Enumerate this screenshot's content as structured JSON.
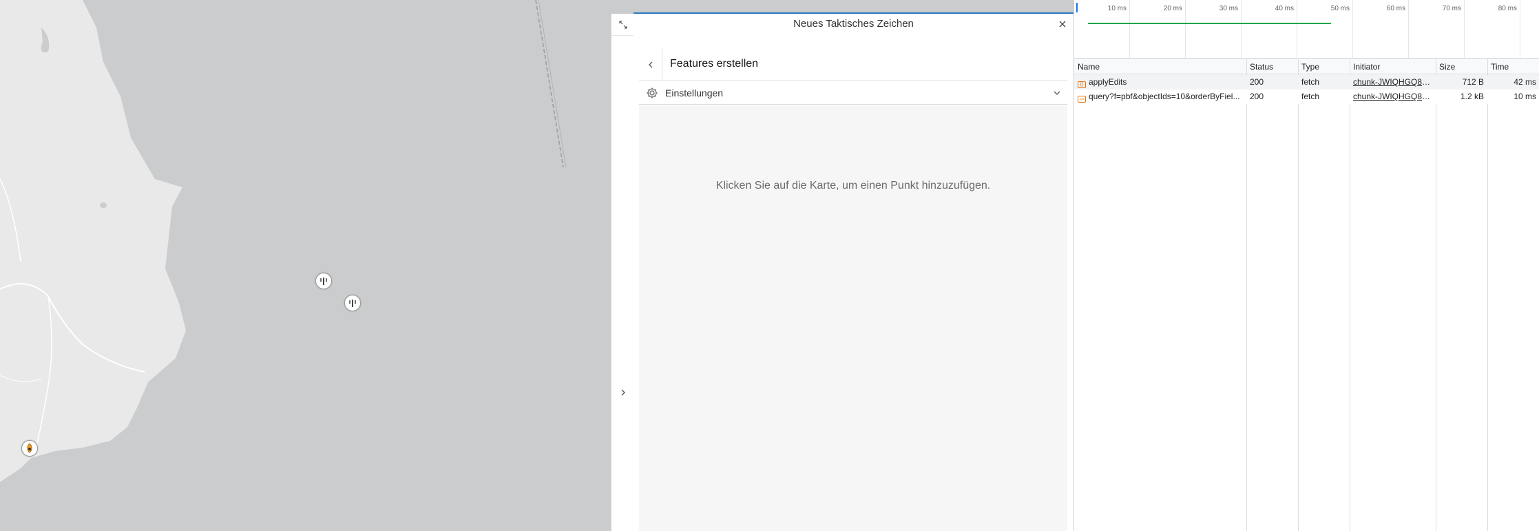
{
  "panel": {
    "title": "Neues Taktisches Zeichen",
    "features_title": "Features erstellen",
    "settings_label": "Einstellungen",
    "hint": "Klicken Sie auf die Karte, um einen Punkt hinzuzufügen."
  },
  "icons": {
    "expand": "expand-icon",
    "collapse": "chevron-right-icon",
    "close": "close-icon",
    "back": "chevron-left-icon",
    "settings": "gear-icon",
    "settings_toggle": "chevron-down-icon",
    "map_marker": "tactical-symbol-icon",
    "map_marker_special": "flame-symbol-icon"
  },
  "colors": {
    "accent": "#2b79c2",
    "timeline_bar": "#20a54b",
    "request_icon": "#e8710a"
  },
  "devtools": {
    "timeline_ticks": [
      "10 ms",
      "20 ms",
      "30 ms",
      "40 ms",
      "50 ms",
      "60 ms",
      "70 ms",
      "80 ms"
    ],
    "columns": [
      "Name",
      "Status",
      "Type",
      "Initiator",
      "Size",
      "Time"
    ],
    "rows": [
      {
        "name": "applyEdits",
        "status": "200",
        "type": "fetch",
        "initiator": "chunk-JWIQHGQ8.j...",
        "size": "712 B",
        "time": "42 ms"
      },
      {
        "name": "query?f=pbf&objectIds=10&orderByFiel...",
        "status": "200",
        "type": "fetch",
        "initiator": "chunk-JWIQHGQ8.j...",
        "size": "1.2 kB",
        "time": "10 ms"
      }
    ]
  }
}
